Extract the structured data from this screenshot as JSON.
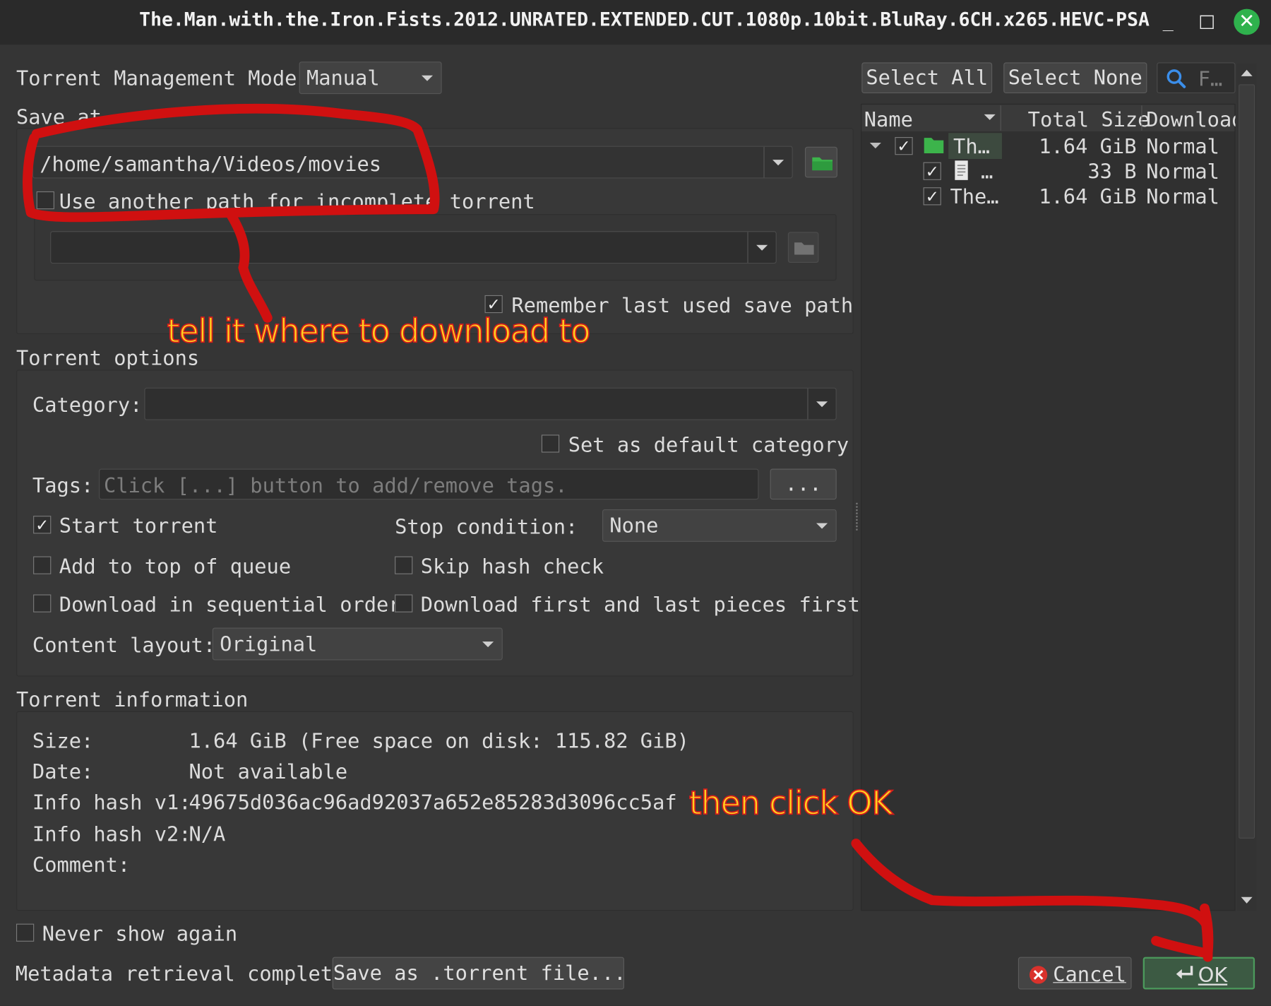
{
  "window": {
    "title": "The.Man.with.the.Iron.Fists.2012.UNRATED.EXTENDED.CUT.1080p.10bit.BluRay.6CH.x265.HEVC-PSA",
    "minimize_glyph": "_",
    "maximize_glyph": "□",
    "close_glyph": "✕"
  },
  "management": {
    "label": "Torrent Management Mode:",
    "value": "Manual"
  },
  "save_at": {
    "label": "Save at",
    "path": "/home/samantha/Videos/movies",
    "use_another_path_label": "Use another path for incomplete torrent",
    "use_another_path_checked": false,
    "incomplete_path": "",
    "remember_label": "Remember last used save path",
    "remember_checked": true
  },
  "torrent_options": {
    "label": "Torrent options",
    "category_label": "Category:",
    "category_value": "",
    "set_default_label": "Set as default category",
    "set_default_checked": false,
    "tags_label": "Tags:",
    "tags_placeholder": "Click [...] button to add/remove tags.",
    "tags_button": "...",
    "start_torrent_label": "Start torrent",
    "start_torrent_checked": true,
    "stop_condition_label": "Stop condition:",
    "stop_condition_value": "None",
    "add_top_label": "Add to top of queue",
    "add_top_checked": false,
    "skip_hash_label": "Skip hash check",
    "skip_hash_checked": false,
    "sequential_label": "Download in sequential order",
    "sequential_checked": false,
    "first_last_label": "Download first and last pieces first",
    "first_last_checked": false,
    "content_layout_label": "Content layout:",
    "content_layout_value": "Original"
  },
  "torrent_info": {
    "label": "Torrent information",
    "size_label": "Size:",
    "size_value": "1.64 GiB (Free space on disk: 115.82 GiB)",
    "date_label": "Date:",
    "date_value": "Not available",
    "hash1_label": "Info hash v1:",
    "hash1_value": "49675d036ac96ad92037a652e85283d3096cc5af",
    "hash2_label": "Info hash v2:",
    "hash2_value": "N/A",
    "comment_label": "Comment:",
    "comment_value": ""
  },
  "files": {
    "select_all": "Select All",
    "select_none": "Select None",
    "filter_placeholder": "F…",
    "columns": [
      "Name",
      "Total Size",
      "Download"
    ],
    "rows": [
      {
        "name": "Th…",
        "size": "1.64 GiB",
        "priority": "Normal",
        "icon": "folder-icon",
        "checked": true
      },
      {
        "name": "…",
        "size": "33 B",
        "priority": "Normal",
        "icon": "file-icon",
        "checked": true
      },
      {
        "name": "The…",
        "size": "1.64 GiB",
        "priority": "Normal",
        "icon": "none",
        "checked": true
      }
    ]
  },
  "footer": {
    "never_show_label": "Never show again",
    "never_show_checked": false,
    "status": "Metadata retrieval complete",
    "save_torrent_button": "Save as .torrent file...",
    "cancel_button": "Cancel",
    "ok_button": "OK"
  },
  "annotations": {
    "path_note": "tell it where to download to",
    "ok_note": "then click OK",
    "color_text": "#ffd21f",
    "color_stroke": "#d41c1c"
  }
}
